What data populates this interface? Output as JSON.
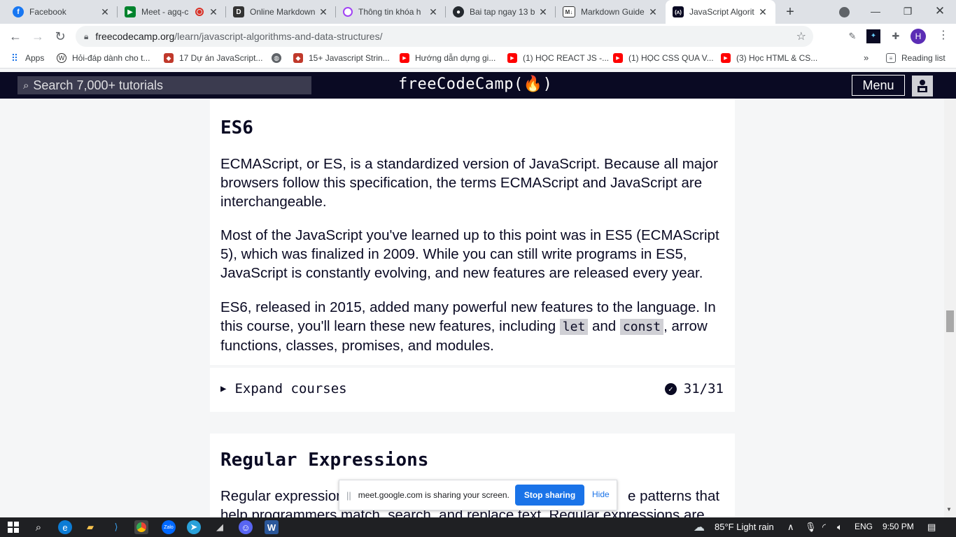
{
  "browser": {
    "tabs": [
      {
        "title": "Facebook",
        "icon": "facebook-icon"
      },
      {
        "title": "Meet - agq-c",
        "icon": "google-meet-icon"
      },
      {
        "title": "Online Markdown",
        "icon": "markdown-editor-icon"
      },
      {
        "title": "Thông tin khóa h",
        "icon": "course-info-icon"
      },
      {
        "title": "Bai tap ngay 13 b",
        "icon": "github-icon"
      },
      {
        "title": "Markdown Guide",
        "icon": "markdown-guide-icon"
      },
      {
        "title": "JavaScript Algorit",
        "icon": "freecodecamp-icon",
        "active": true
      }
    ],
    "url_host": "freecodecamp.org",
    "url_path": "/learn/javascript-algorithms-and-data-structures/",
    "profile_initial": "H",
    "bookmarks": [
      {
        "label": "Apps",
        "icon": "apps-grid-icon"
      },
      {
        "label": "Hỏi-đáp dành cho t...",
        "icon": "wordpress-icon"
      },
      {
        "label": "17 Dự án JavaScript...",
        "icon": "tutorial-site-icon"
      },
      {
        "label": "",
        "icon": "globe-icon"
      },
      {
        "label": "15+ Javascript Strin...",
        "icon": "tutorial-site-icon"
      },
      {
        "label": "Hướng dẫn dựng gi...",
        "icon": "youtube-icon"
      },
      {
        "label": "(1) HỌC REACT JS -...",
        "icon": "youtube-icon"
      },
      {
        "label": "(1) HỌC CSS QUA V...",
        "icon": "youtube-icon"
      },
      {
        "label": "(3) Học HTML & CS...",
        "icon": "youtube-icon"
      }
    ],
    "bookmarks_more": "»",
    "reading_list": "Reading list"
  },
  "fcc": {
    "search_placeholder": "Search 7,000+ tutorials",
    "logo": "freeCodeCamp(🔥)",
    "menu_label": "Menu"
  },
  "sections": {
    "es6": {
      "title": "ES6",
      "p1": "ECMAScript, or ES, is a standardized version of JavaScript. Because all major browsers follow this specification, the terms ECMAScript and JavaScript are interchangeable.",
      "p2": "Most of the JavaScript you've learned up to this point was in ES5 (ECMAScript 5), which was finalized in 2009. While you can still write programs in ES5, JavaScript is constantly evolving, and new features are released every year.",
      "p3_a": "ES6, released in 2015, added many powerful new features to the language. In this course, you'll learn these new features, including ",
      "p3_code1": "let",
      "p3_and": " and ",
      "p3_code2": "const",
      "p3_b": ", arrow functions, classes, promises, and modules.",
      "expand_label": "Expand courses",
      "progress": "31/31"
    },
    "regex": {
      "title": "Regular Expressions",
      "p1_start": "Regular expression",
      "p1_end": "e patterns that",
      "p1_line2": "help programmers match, search, and replace text. Regular expressions are"
    }
  },
  "share_banner": {
    "message": "meet.google.com is sharing your screen.",
    "stop_label": "Stop sharing",
    "hide_label": "Hide"
  },
  "taskbar": {
    "weather": "85°F  Light rain",
    "language": "ENG",
    "time": "9:50 PM"
  }
}
